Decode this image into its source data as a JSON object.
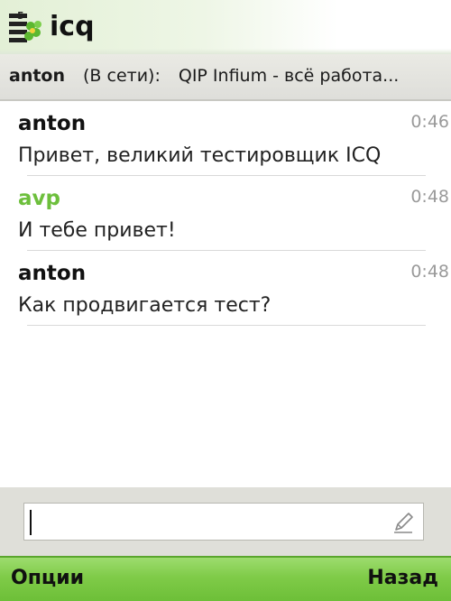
{
  "app": {
    "title": "icq"
  },
  "status": {
    "contact_name": "anton",
    "state": "(В сети):",
    "message": "QIP Infium - всё работа..."
  },
  "messages": [
    {
      "sender": "anton",
      "time": "0:46",
      "text": "Привет, великий тестировщик ICQ",
      "own": false
    },
    {
      "sender": "avp",
      "time": "0:48",
      "text": "И тебе привет!",
      "own": true
    },
    {
      "sender": "anton",
      "time": "0:48",
      "text": "Как продвигается тест?",
      "own": false
    }
  ],
  "input": {
    "value": ""
  },
  "softkeys": {
    "left": "Опции",
    "right": "Назад"
  },
  "colors": {
    "accent_green": "#6dbf3c",
    "softkey_bar": "#7fcb48"
  },
  "icons": {
    "logo": "icq-flower-logo",
    "edit": "pencil-icon"
  }
}
